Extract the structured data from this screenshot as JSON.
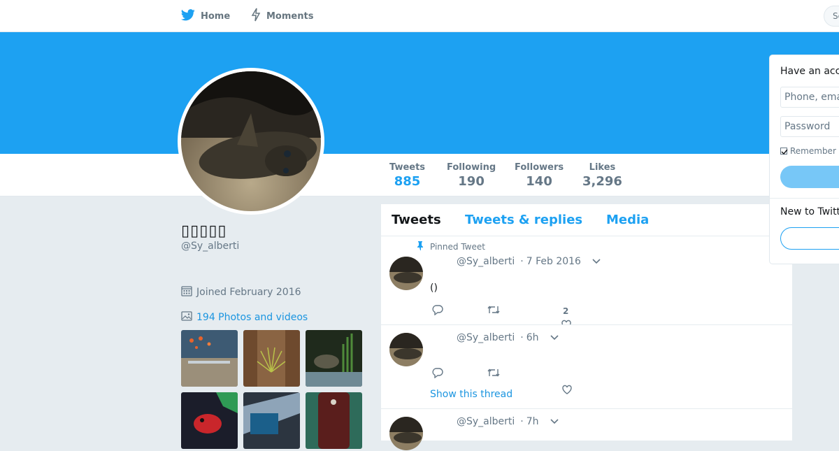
{
  "nav": {
    "home_label": "Home",
    "moments_label": "Moments",
    "search_placeholder": "Se"
  },
  "profile": {
    "name": "▯▯▯▯▯",
    "handle": "@Sy_alberti",
    "joined": "Joined February 2016",
    "photos_link": "194 Photos and videos"
  },
  "stats": [
    {
      "label": "Tweets",
      "value": "885"
    },
    {
      "label": "Following",
      "value": "190"
    },
    {
      "label": "Followers",
      "value": "140"
    },
    {
      "label": "Likes",
      "value": "3,296"
    }
  ],
  "timeline": {
    "tabs": [
      "Tweets",
      "Tweets & replies",
      "Media"
    ],
    "pinned_label": "Pinned Tweet",
    "tweets": [
      {
        "handle": "@Sy_alberti",
        "time": "7 Feb 2016",
        "text": "()",
        "like_count": "2"
      },
      {
        "handle": "@Sy_alberti",
        "time": "6h",
        "show_thread": "Show this thread"
      },
      {
        "handle": "@Sy_alberti",
        "time": "7h"
      }
    ]
  },
  "login": {
    "title": "Have an acc",
    "phone_placeholder": "Phone, ema",
    "password_placeholder": "Password",
    "remember": "Remember m",
    "new_to": "New to Twitt"
  },
  "colors": {
    "brand_blue": "#1da1f2",
    "link_blue": "#1b95e0",
    "page_bg": "#e6ecf0",
    "muted_text": "#657786"
  },
  "icons": [
    "twitter-bird-icon",
    "lightning-icon",
    "calendar-icon",
    "photo-icon",
    "pin-icon",
    "reply-icon",
    "retweet-icon",
    "like-icon",
    "chevron-down-icon"
  ]
}
